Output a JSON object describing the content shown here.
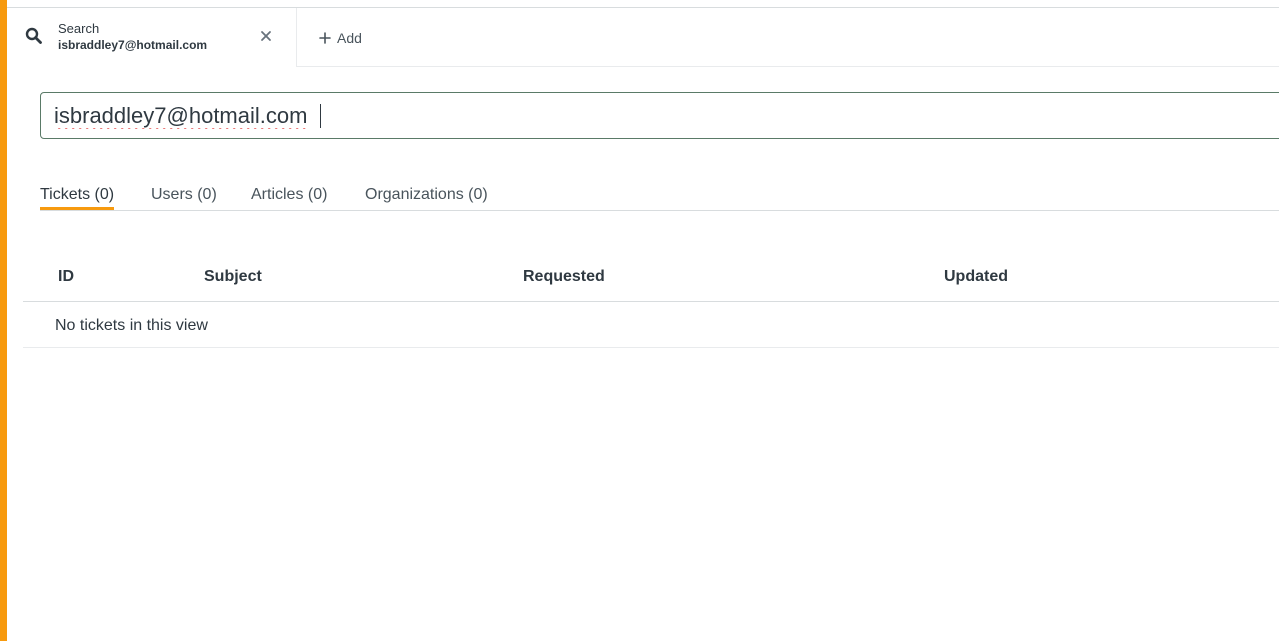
{
  "tab_bar": {
    "search_tab": {
      "title": "Search",
      "subtitle": "isbraddley7@hotmail.com",
      "icon": "search-icon",
      "close_icon": "close-icon"
    },
    "add_tab": {
      "label": "Add",
      "icon": "plus-icon"
    }
  },
  "search": {
    "value": "isbraddley7@hotmail.com"
  },
  "result_tabs": [
    {
      "label": "Tickets (0)",
      "active": true
    },
    {
      "label": "Users (0)",
      "active": false
    },
    {
      "label": "Articles (0)",
      "active": false
    },
    {
      "label": "Organizations (0)",
      "active": false
    }
  ],
  "table": {
    "columns": [
      "ID",
      "Subject",
      "Requested",
      "Updated"
    ],
    "empty_message": "No tickets in this view"
  },
  "colors": {
    "accent": "#f79a0e",
    "input_border": "#5a7a67",
    "text": "#2f3941",
    "spellcheck": "#e03535"
  }
}
